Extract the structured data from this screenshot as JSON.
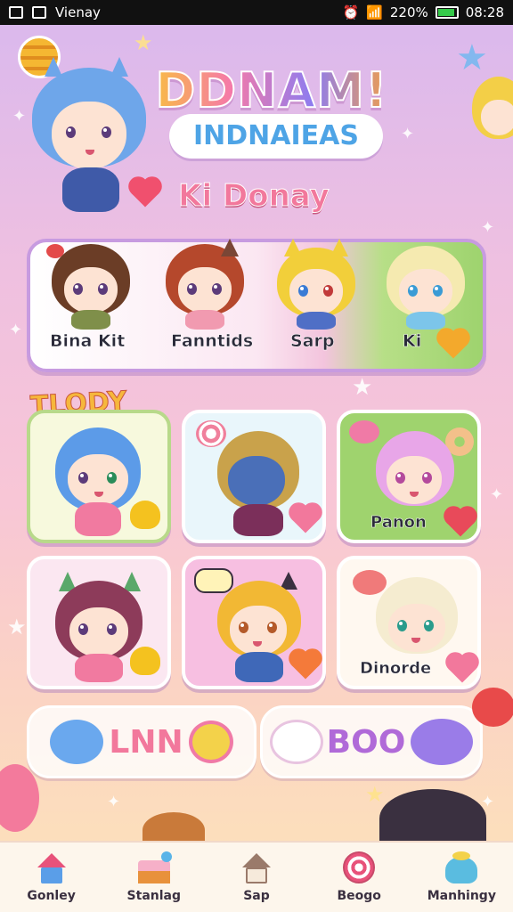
{
  "status_bar": {
    "app_name": "Vienay",
    "battery": "220%",
    "time": "08:28"
  },
  "header": {
    "title": "DDNAM!",
    "subtitle": "INDNAIEAS",
    "greeting": "Ki Donay"
  },
  "friends": [
    {
      "label": "Bina Kit",
      "hair": "#6b3d26",
      "outfit": "#7f8f4a",
      "accent": "#e34a4a"
    },
    {
      "label": "Fanntids",
      "hair": "#b5482c",
      "outfit": "#f19ab0",
      "accent": "#7a4636"
    },
    {
      "label": "Sarp",
      "hair": "#f2cf3a",
      "outfit": "#4f6fc6",
      "accent": "#e8b72c"
    },
    {
      "label": "Ki",
      "hair": "#f5eab0",
      "outfit": "#7cc5ea",
      "accent": "#e6d57b"
    }
  ],
  "section_title": "TLODY",
  "cards": [
    {
      "label": "",
      "bg": "#f7f9dd",
      "border": "#b8d98a",
      "hair": "#5c9be8",
      "outfit": "#f17aa0"
    },
    {
      "label": "",
      "bg": "#e9f6fb",
      "border": "#ffffff",
      "hair": "#c9a24b",
      "outfit": "#7b2f5a"
    },
    {
      "label": "Panon",
      "bg": "#9fd36e",
      "border": "#ffffff",
      "hair": "#e8a6e8",
      "outfit": "#f2d0e6"
    },
    {
      "label": "",
      "bg": "#fbe7f1",
      "border": "#ffffff",
      "hair": "#8d3b5a",
      "outfit": "#f17aa0"
    },
    {
      "label": "",
      "bg": "#f7bfe1",
      "border": "#ffffff",
      "hair": "#f2b834",
      "outfit": "#3f68b8"
    },
    {
      "label": "Dinorde",
      "bg": "#fff8f0",
      "border": "#ffffff",
      "hair": "#f5ecd0",
      "outfit": "#4fa1c8"
    }
  ],
  "buttons": {
    "left_label": "LNN",
    "right_label": "BOO"
  },
  "nav": [
    {
      "label": "Gonley",
      "icon": "home-icon"
    },
    {
      "label": "Stanlag",
      "icon": "cake-icon"
    },
    {
      "label": "Sap",
      "icon": "house-icon"
    },
    {
      "label": "Beogo",
      "icon": "lollipop-icon"
    },
    {
      "label": "Manhingy",
      "icon": "slime-icon"
    }
  ],
  "colors": {
    "accent_pink": "#f2789c",
    "accent_purple": "#c79be0",
    "accent_green": "#9ed36e"
  }
}
